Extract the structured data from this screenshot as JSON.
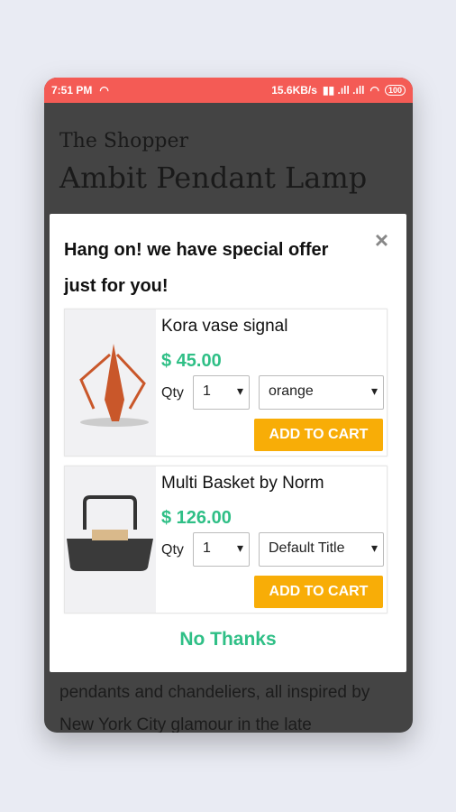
{
  "status_bar": {
    "time": "7:51 PM",
    "speed": "15.6KB/s",
    "battery": "100"
  },
  "page": {
    "store_name": "The Shopper",
    "product_title": "Ambit Pendant Lamp",
    "description": "The Tribeca series is a mix of lamps, pendants and chandeliers, all inspired by New York City glamour in the late"
  },
  "modal": {
    "title": "Hang on! we have special offer just for you!",
    "close": "×",
    "no_thanks": "No Thanks",
    "products": [
      {
        "name": "Kora vase signal",
        "price": "$ 45.00",
        "qty_label": "Qty",
        "qty": "1",
        "variant": "orange",
        "add_label": "ADD TO CART"
      },
      {
        "name": "Multi Basket by Norm",
        "price": "$ 126.00",
        "qty_label": "Qty",
        "qty": "1",
        "variant": "Default Title",
        "add_label": "ADD TO CART"
      }
    ]
  },
  "colors": {
    "status_bar": "#f45b55",
    "price": "#2fbf86",
    "add_button": "#f8ad07"
  }
}
